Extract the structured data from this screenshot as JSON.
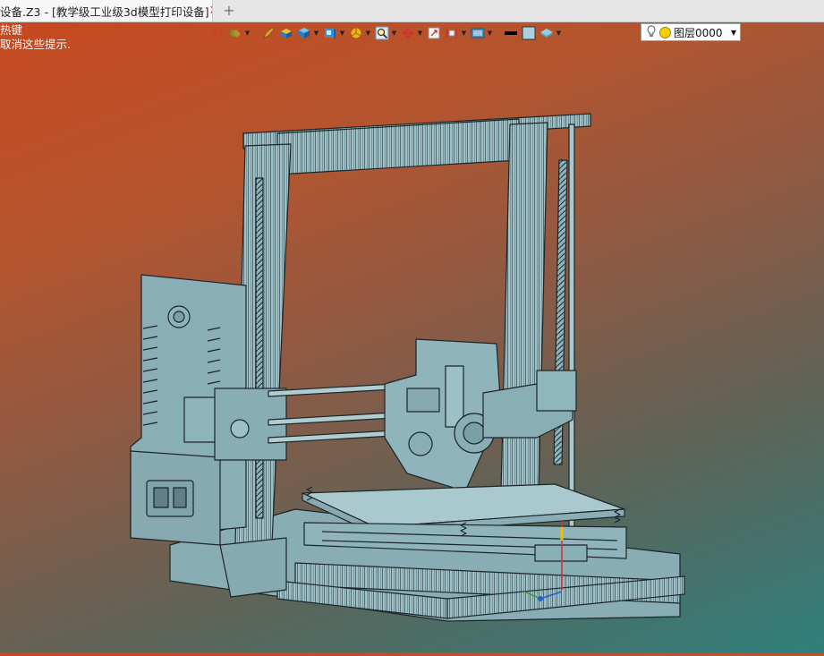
{
  "tab": {
    "title": "设备.Z3 - [教学级工业级3d模型打印设备]",
    "close": "✕",
    "new": "+"
  },
  "hint": {
    "line1": "热键",
    "line2": "取消这些提示."
  },
  "layer": {
    "name": "图层0000"
  },
  "toolbar_icons": [
    "exit-icon",
    "paint-bucket-icon",
    "pencil-icon",
    "box-solid-icon",
    "cube-icon",
    "cube-view-icon",
    "pie-render-icon",
    "zoom-icon",
    "rotate-axis-icon",
    "fit-window-icon",
    "section-view-icon",
    "display-mode-icon",
    "line-color-icon",
    "fill-color-icon",
    "layer-visibility-icon",
    "bulb-icon"
  ],
  "colors": {
    "model": "#8fb4bb",
    "model_edge": "#1c2529",
    "bg_top": "#c9481e",
    "bg_bottom": "#2f7f7c",
    "tab_close": "#c0392b"
  }
}
